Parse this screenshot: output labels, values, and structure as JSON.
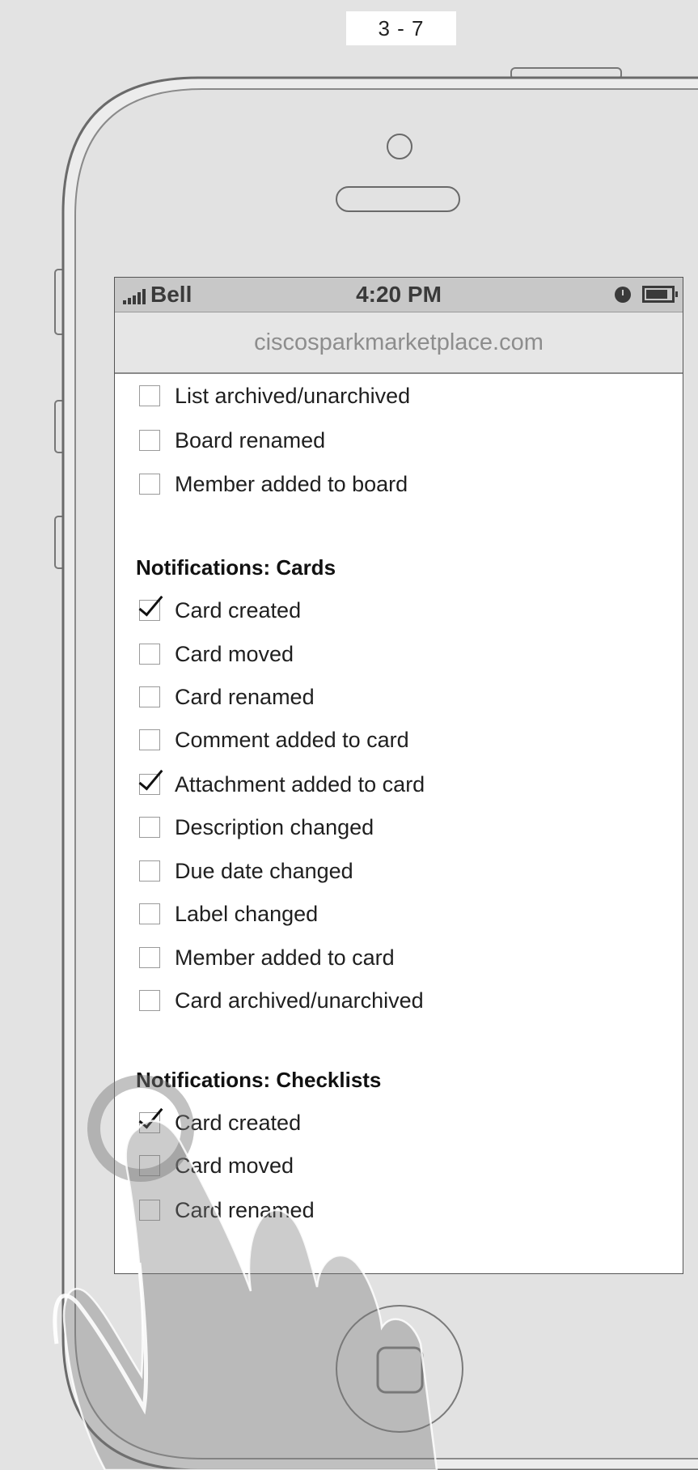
{
  "page_label": "3 - 7",
  "status_bar": {
    "carrier": "Bell",
    "time": "4:20 PM",
    "signal_icon": "signal-bars-icon",
    "alarm_icon": "alarm-clock-icon",
    "battery_icon": "battery-icon"
  },
  "url_bar": {
    "url": "ciscosparkmarketplace.com"
  },
  "board_items": [
    {
      "label": "List archived/unarchived",
      "checked": false
    },
    {
      "label": "Board renamed",
      "checked": false
    },
    {
      "label": "Member added to board",
      "checked": false
    }
  ],
  "cards_section": {
    "title": "Notifications: Cards",
    "items": [
      {
        "label": "Card created",
        "checked": true
      },
      {
        "label": "Card moved",
        "checked": false
      },
      {
        "label": "Card renamed",
        "checked": false
      },
      {
        "label": "Comment added to card",
        "checked": false
      },
      {
        "label": "Attachment added to card",
        "checked": true
      },
      {
        "label": "Description changed",
        "checked": false
      },
      {
        "label": "Due date changed",
        "checked": false
      },
      {
        "label": "Label changed",
        "checked": false
      },
      {
        "label": "Member added to card",
        "checked": false
      },
      {
        "label": "Card archived/unarchived",
        "checked": false
      }
    ]
  },
  "checklists_section": {
    "title": "Notifications: Checklists",
    "items": [
      {
        "label": "Card created",
        "checked": true
      },
      {
        "label": "Card moved",
        "checked": false
      },
      {
        "label": "Card renamed",
        "checked": false
      }
    ]
  },
  "colors": {
    "background": "#e3e3e3",
    "status_bar": "#c8c8c8",
    "url_bar": "#e6e6e6",
    "url_text": "#8d8d8d"
  }
}
